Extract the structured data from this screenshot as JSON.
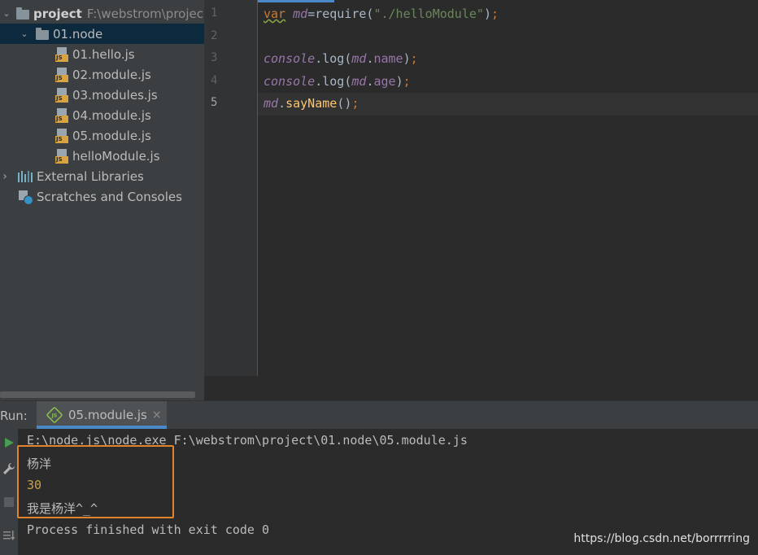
{
  "project_tree": {
    "root": {
      "name": "project",
      "path": "F:\\webstrom\\projec"
    },
    "folder": {
      "name": "01.node"
    },
    "files": [
      "01.hello.js",
      "02.module.js",
      "03.modules.js",
      "04.module.js",
      "05.module.js",
      "helloModule.js"
    ],
    "file_icon_text": "JS",
    "external_libraries": "External Libraries",
    "scratches": "Scratches and Consoles"
  },
  "editor": {
    "line_numbers": [
      "1",
      "2",
      "3",
      "4",
      "5"
    ],
    "current_line": "5",
    "code": {
      "l1": {
        "kw": "var",
        "var": "md",
        "eq": "=require(",
        "str": "\"./helloModule\"",
        "close": ")",
        "semi": ";"
      },
      "l3": {
        "obj": "console",
        "dot": ".log(",
        "var": "md",
        "dot2": ".",
        "prop": "name",
        "close": ")",
        "semi": ";"
      },
      "l4": {
        "obj": "console",
        "dot": ".log(",
        "var": "md",
        "dot2": ".",
        "prop": "age",
        "close": ")",
        "semi": ";"
      },
      "l5": {
        "var": "md",
        "dot": ".",
        "fn": "sayName",
        "call": "()",
        "semi": ";"
      }
    }
  },
  "run_panel": {
    "label": "Run:",
    "tab_label": "05.module.js",
    "tab_close": "×",
    "node_icon_text": "JS",
    "console_lines": [
      "E:\\node.js\\node.exe F:\\webstrom\\project\\01.node\\05.module.js",
      "杨洋",
      "30",
      "我是杨洋^_^",
      "Process finished with exit code 0"
    ]
  },
  "watermark": "https://blog.csdn.net/borrrrring",
  "colors": {
    "background": "#2b2b2b",
    "panel": "#3c3f41",
    "selection": "#0d293e",
    "accent_blue": "#4a88c7",
    "highlight_box": "#e0852e",
    "number_yellow": "#c8a24a"
  }
}
